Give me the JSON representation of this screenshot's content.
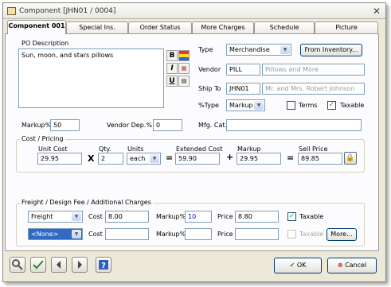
{
  "window": {
    "title": "Component [JHN01 / 0004]"
  },
  "tabs": [
    {
      "label": "Component 001"
    },
    {
      "label": "Special Ins."
    },
    {
      "label": "Order Status"
    },
    {
      "label": "More Charges"
    },
    {
      "label": "Schedule"
    },
    {
      "label": "Picture"
    }
  ],
  "po": {
    "label": "PO Description",
    "text": "Sun, moon, and stars pillows"
  },
  "type": {
    "label": "Type",
    "value": "Merchandise",
    "inventory_btn": "From Inventory..."
  },
  "vendor": {
    "label": "Vendor",
    "code": "PILL",
    "name": "Pillows and More"
  },
  "shipto": {
    "label": "Ship To",
    "code": "JHN01",
    "name": "Mr. and Mrs. Robert Johnson"
  },
  "pctype": {
    "label": "%Type",
    "value": "Markup",
    "terms_label": "Terms",
    "taxable_label": "Taxable"
  },
  "markup_pct": {
    "label": "Markup%",
    "value": "50"
  },
  "vendor_dep": {
    "label": "Vendor Dep.%",
    "value": "0"
  },
  "mfg": {
    "label": "Mfg. Cat.",
    "value": ""
  },
  "cost": {
    "group": "Cost / Pricing",
    "unit_cost_label": "Unit Cost",
    "unit_cost": "29.95",
    "x": "X",
    "qty_label": "Qty.",
    "qty": "2",
    "units_label": "Units",
    "units": "each",
    "eq1": "=",
    "ext_label": "Extended Cost",
    "ext": "59.90",
    "plus": "+",
    "markup_label": "Markup",
    "markup": "29.95",
    "eq2": "=",
    "sell_label": "Sell Price",
    "sell": "89.85"
  },
  "freight": {
    "group": "Freight / Design Fee / Additional Charges",
    "row1": {
      "type": "Freight",
      "cost_label": "Cost",
      "cost": "8.00",
      "markup_label": "Markup%",
      "markup": "10",
      "price_label": "Price",
      "price": "8.80",
      "taxable": "Taxable"
    },
    "row2": {
      "type": "<None>",
      "cost_label": "Cost",
      "cost": "",
      "markup_label": "Markup%",
      "markup": "",
      "price_label": "Price",
      "price": "",
      "taxable": "Taxable",
      "more": "More..."
    }
  },
  "buttons": {
    "ok": "OK",
    "cancel": "Cancel"
  }
}
